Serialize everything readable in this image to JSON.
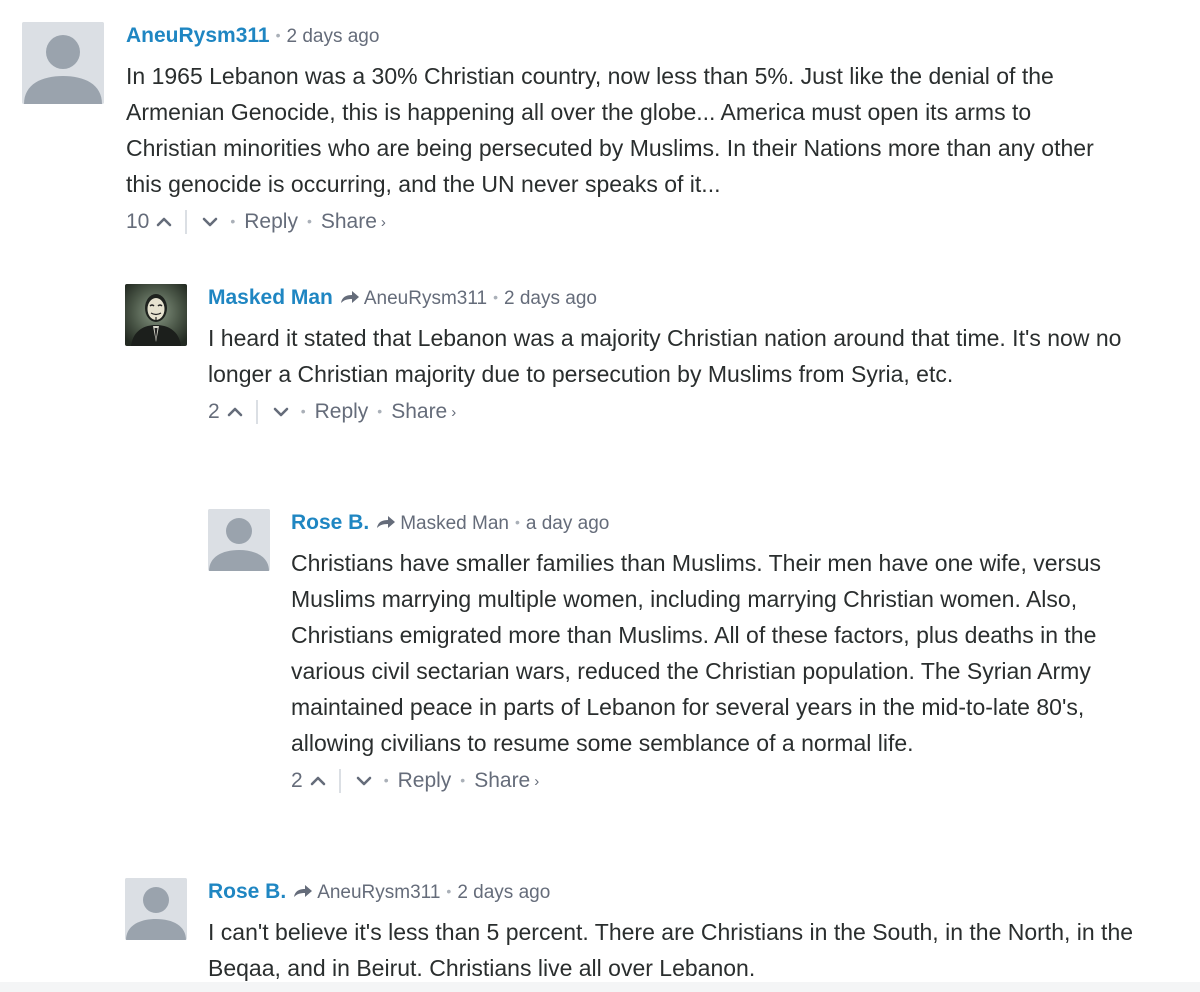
{
  "comments": [
    {
      "author": "AneuRysm311",
      "parent": "",
      "time": "2 days ago",
      "avatar": "placeholder-avatar",
      "text": "In 1965 Lebanon was a 30% Christian country, now less than 5%. Just like the denial of the Armenian Genocide, this is happening all over the globe... America must open its arms to Christian minorities who are being persecuted by Muslims. In their Nations more than any other this genocide is occurring, and the UN never speaks of it...",
      "votes": "10",
      "reply_label": "Reply",
      "share_label": "Share"
    },
    {
      "author": "Masked Man",
      "parent": "AneuRysm311",
      "time": "2 days ago",
      "avatar": "masked-man-avatar",
      "text": "I heard it stated that Lebanon was a majority Christian nation around that time. It's now no longer a Christian majority due to persecution by Muslims from Syria, etc.",
      "votes": "2",
      "reply_label": "Reply",
      "share_label": "Share"
    },
    {
      "author": "Rose B.",
      "parent": "Masked Man",
      "time": "a day ago",
      "avatar": "placeholder-avatar",
      "text": "Christians have smaller families than Muslims. Their men have one wife, versus Muslims marrying multiple women, including marrying Christian women. Also, Christians emigrated more than Muslims. All of these factors, plus deaths in the various civil sectarian wars, reduced the Christian population. The Syrian Army maintained peace in parts of Lebanon for several years in the mid-to-late 80's, allowing civilians to resume some semblance of a normal life.",
      "votes": "2",
      "reply_label": "Reply",
      "share_label": "Share"
    },
    {
      "author": "Rose B.",
      "parent": "AneuRysm311",
      "time": "2 days ago",
      "avatar": "placeholder-avatar",
      "text": "I can't believe it's less than 5 percent. There are Christians in the South, in the North, in the Beqaa, and in Beirut. Christians live all over Lebanon."
    }
  ],
  "symbols": {
    "bullet": "•",
    "share_chevron": "›"
  },
  "colors": {
    "author": "#1f86c2",
    "meta": "#656c7a",
    "text": "#2a2e2e",
    "avatar_bg": "#dbdfe4",
    "avatar_fg": "#9aa3ad"
  }
}
